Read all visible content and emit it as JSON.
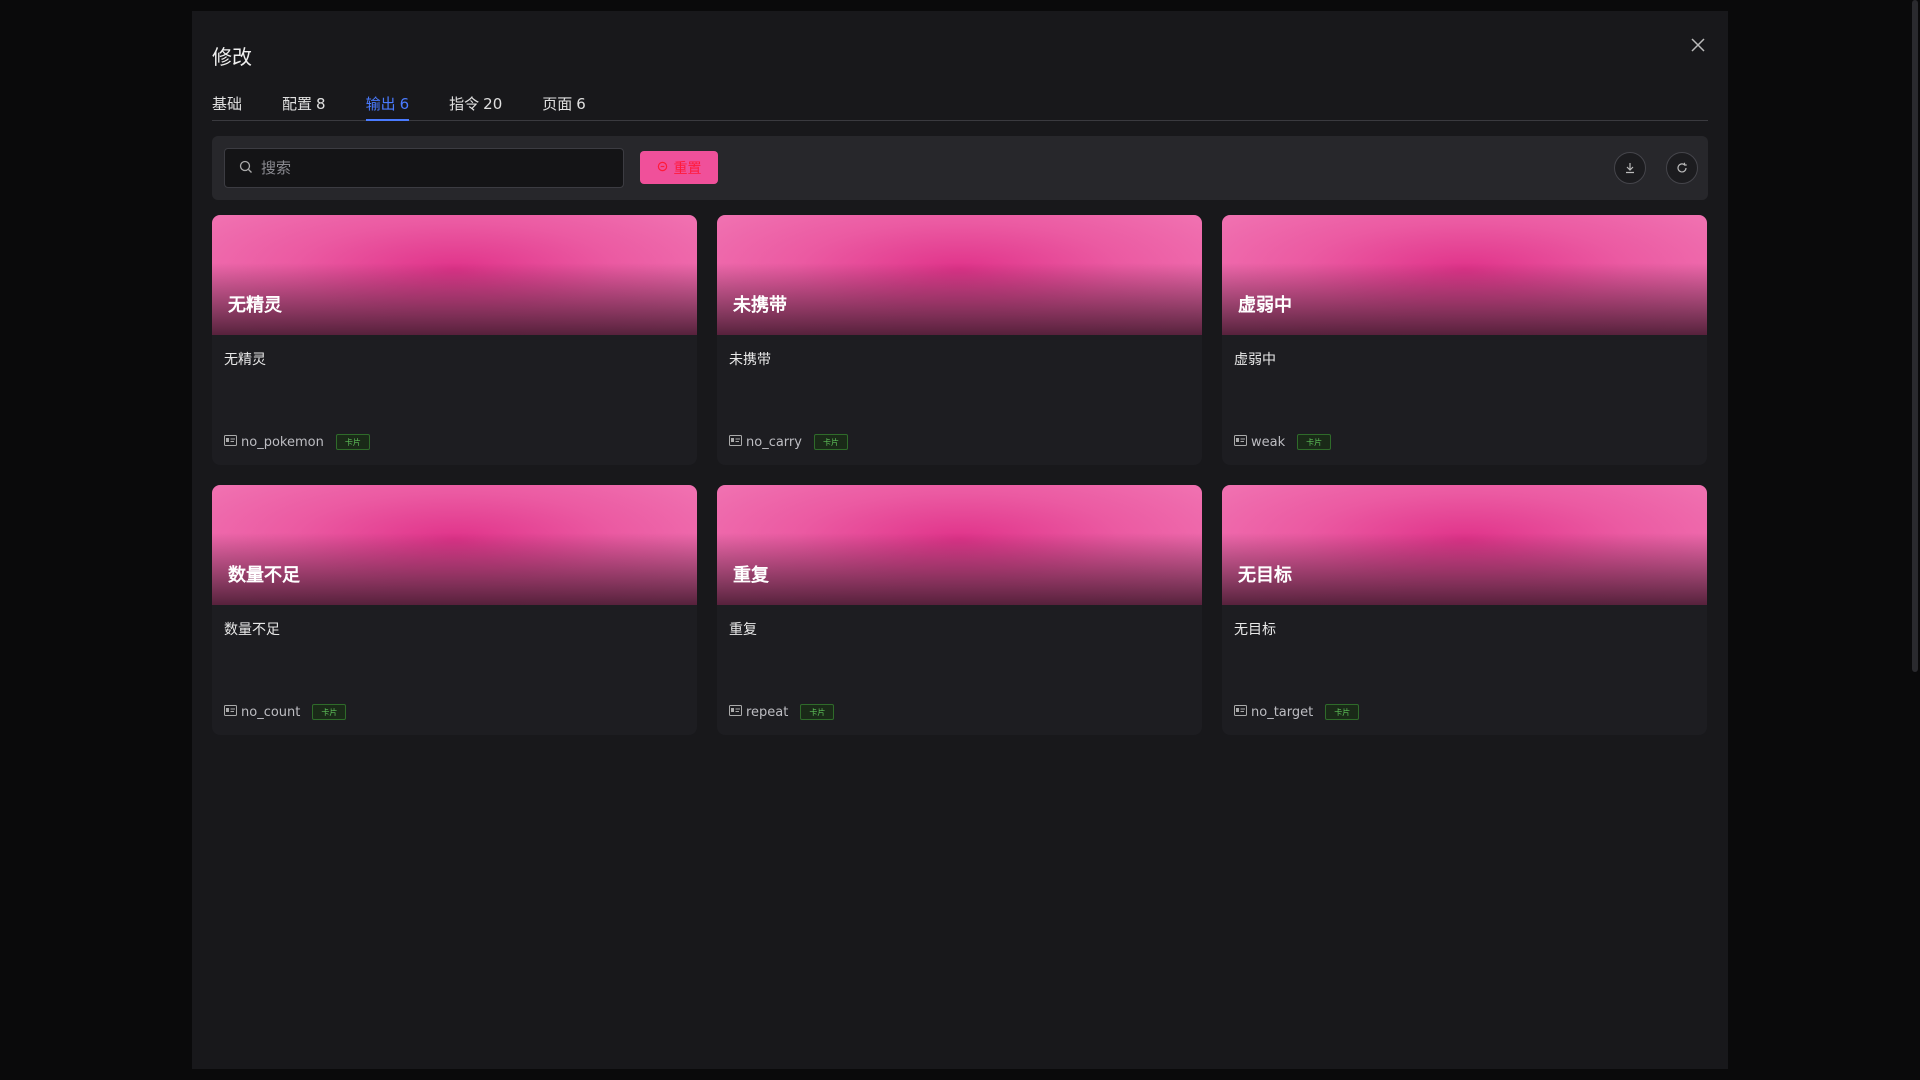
{
  "modal": {
    "title": "修改",
    "close_label": "×"
  },
  "tabs": [
    {
      "label": "基础",
      "count": ""
    },
    {
      "label": "配置",
      "count": "8"
    },
    {
      "label": "输出",
      "count": "6",
      "active": true
    },
    {
      "label": "指令",
      "count": "20"
    },
    {
      "label": "页面",
      "count": "6"
    }
  ],
  "toolbar": {
    "search_placeholder": "搜索",
    "reset_label": "重置"
  },
  "cards": [
    {
      "banner_title": "无精灵",
      "desc": "无精灵",
      "id": "no_pokemon",
      "tag": "卡片"
    },
    {
      "banner_title": "未携带",
      "desc": "未携带",
      "id": "no_carry",
      "tag": "卡片"
    },
    {
      "banner_title": "虚弱中",
      "desc": "虚弱中",
      "id": "weak",
      "tag": "卡片"
    },
    {
      "banner_title": "数量不足",
      "desc": "数量不足",
      "id": "no_count",
      "tag": "卡片"
    },
    {
      "banner_title": "重复",
      "desc": "重复",
      "id": "repeat",
      "tag": "卡片"
    },
    {
      "banner_title": "无目标",
      "desc": "无目标",
      "id": "no_target",
      "tag": "卡片"
    }
  ],
  "colors": {
    "accent": "#4a7bff",
    "reset_bg": "#f0509a",
    "reset_text": "#ff1a3a",
    "card_banner": "#e0338a",
    "tag_green": "#5fc25a"
  }
}
